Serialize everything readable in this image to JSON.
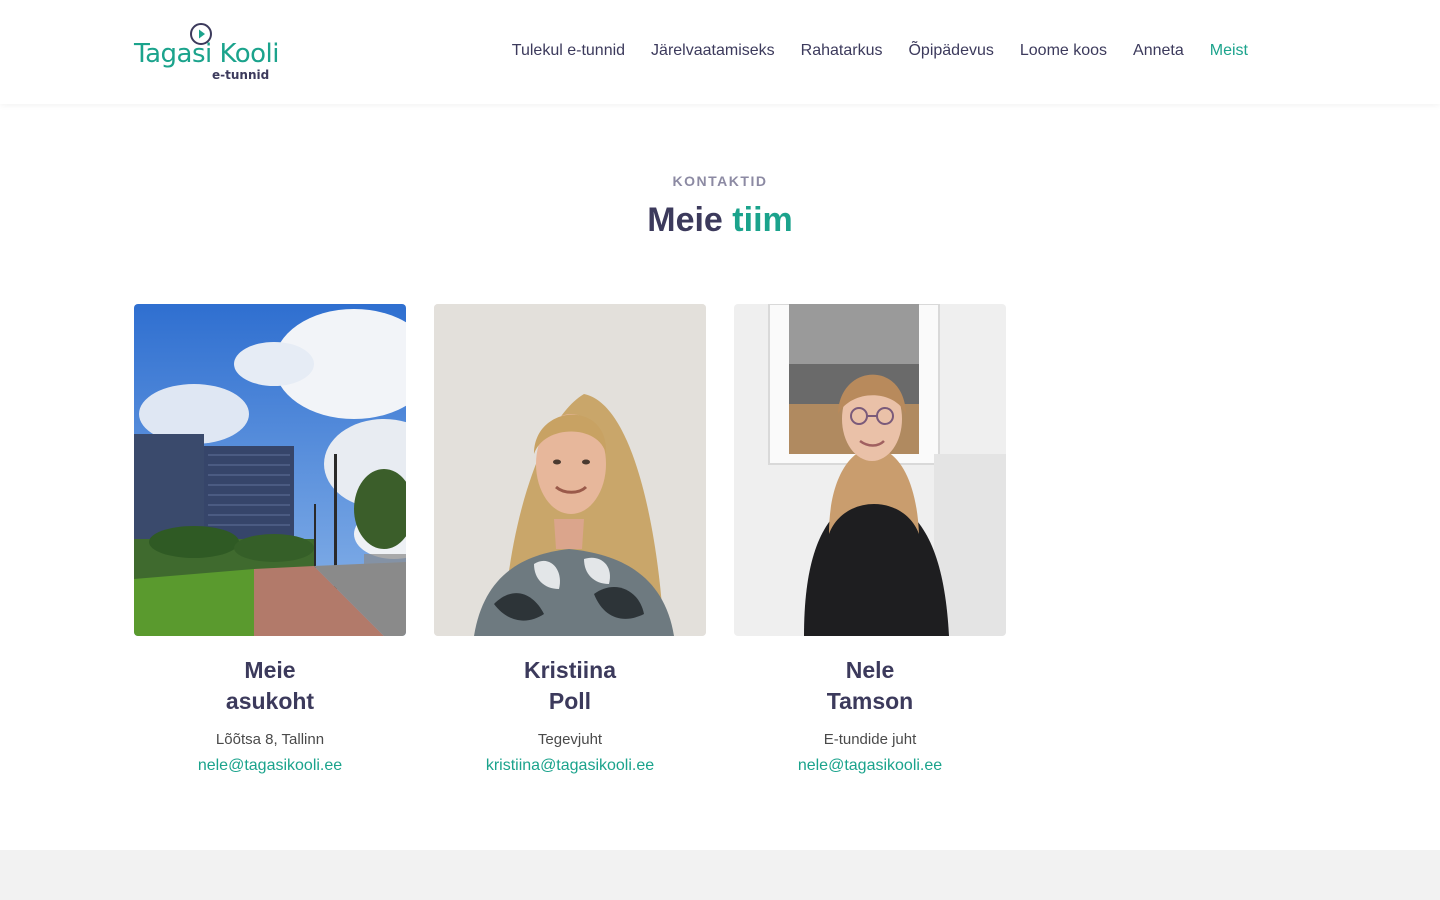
{
  "brand": {
    "name": "Tagasi Kooli",
    "sub": "e-tunnid"
  },
  "nav": [
    {
      "label": "Tulekul e-tunnid"
    },
    {
      "label": "Järelvaatamiseks"
    },
    {
      "label": "Rahatarkus"
    },
    {
      "label": "Õpipädevus"
    },
    {
      "label": "Loome koos"
    },
    {
      "label": "Anneta"
    },
    {
      "label": "Meist",
      "active": true
    }
  ],
  "section": {
    "eyebrow": "KONTAKTID",
    "title_part1": "Meie",
    "title_part2": "tiim"
  },
  "cards": [
    {
      "name_line1": "Meie",
      "name_line2": "asukoht",
      "role": "Lõõtsa 8, Tallinn",
      "email": "nele@tagasikooli.ee"
    },
    {
      "name_line1": "Kristiina",
      "name_line2": "Poll",
      "role": "Tegevjuht",
      "email": "kristiina@tagasikooli.ee"
    },
    {
      "name_line1": "Nele",
      "name_line2": "Tamson",
      "role": "E-tundide juht",
      "email": "nele@tagasikooli.ee"
    }
  ],
  "colors": {
    "accent": "#1ba38c",
    "text": "#3c3a5c",
    "muted": "#8c8aa3",
    "footer": "#f2f2f2"
  }
}
